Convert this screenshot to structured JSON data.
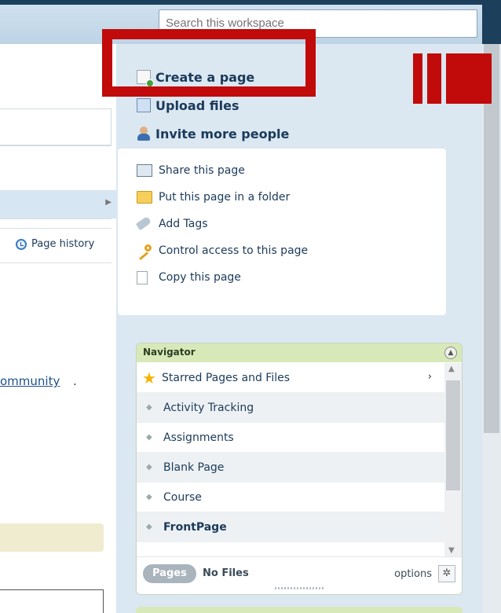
{
  "search": {
    "placeholder": "Search this workspace"
  },
  "actions": [
    {
      "label": "Create a page",
      "icon": "page-plus-icon"
    },
    {
      "label": "Upload files",
      "icon": "upload-icon"
    },
    {
      "label": "Invite more people",
      "icon": "people-icon"
    }
  ],
  "share_menu": [
    {
      "label": "Share this page",
      "icon": "envelope-icon"
    },
    {
      "label": "Put this page in a folder",
      "icon": "folder-icon"
    },
    {
      "label": "Add Tags",
      "icon": "tag-icon"
    },
    {
      "label": "Control access to this page",
      "icon": "key-icon"
    },
    {
      "label": "Copy this page",
      "icon": "copy-icon"
    }
  ],
  "left": {
    "page_history": "Page history",
    "community_link": "ommunity",
    "community_punct": "."
  },
  "navigator": {
    "title": "Navigator",
    "starred": "Starred Pages and Files",
    "items": [
      "Activity Tracking",
      "Assignments",
      "Blank Page",
      "Course",
      "FrontPage"
    ],
    "footer": {
      "pages": "Pages",
      "files": "No Files",
      "options": "options"
    }
  },
  "colors": {
    "highlight_red": "#c10a0a",
    "accent_green": "#d8e9b9",
    "dark_blue": "#1c3f5b"
  }
}
